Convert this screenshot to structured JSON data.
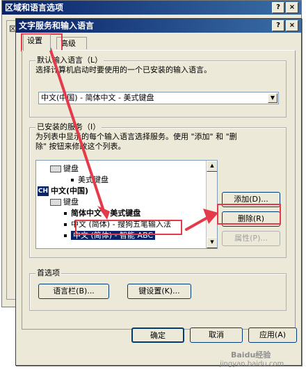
{
  "back_window": {
    "title": "区域和语言选项",
    "help_glyph": "?",
    "close_glyph": "×",
    "tab_fragment": "区"
  },
  "dialog": {
    "title": "文字服务和输入语言",
    "help_glyph": "?",
    "close_glyph": "×",
    "tabs": [
      {
        "label": "设置",
        "active": true
      },
      {
        "label": "高级",
        "active": false
      }
    ]
  },
  "default_language": {
    "legend": "默认输入语言（L）",
    "description": "选择计算机启动时要使用的一个已安装的输入语言。",
    "selected": "中文(中国) - 简体中文 - 美式键盘"
  },
  "installed_services": {
    "legend": "已安装的服务（I）",
    "description_line1": "为列表中显示的每个输入语言选择服务。使用 \"添加\" 和 \"删",
    "description_line2": "除\" 按钮来修改这个列表。",
    "items": [
      {
        "kind": "category",
        "icon": "keyboard-icon",
        "label": "键盘"
      },
      {
        "kind": "service",
        "label": "美式键盘"
      },
      {
        "kind": "language",
        "icon_text": "CH",
        "label": "中文(中国)"
      },
      {
        "kind": "category",
        "icon": "keyboard-icon",
        "label": "键盘"
      },
      {
        "kind": "service",
        "label": "简体中文 - 美式键盘",
        "bold": true
      },
      {
        "kind": "service",
        "label": "中文 (简体) - 搜狗五笔输入法"
      },
      {
        "kind": "service",
        "label": "中文 (简体) - 智能 ABC",
        "selected": true
      }
    ],
    "buttons": {
      "add": "添加(D)...",
      "remove": "删除(R)",
      "properties": "属性(P)..."
    }
  },
  "preferences": {
    "legend": "首选项",
    "language_bar": "语言栏(B)...",
    "key_settings": "键设置(K)..."
  },
  "footer": {
    "ok": "确定",
    "cancel": "取消",
    "apply": "应用(A)"
  },
  "watermark": {
    "line1": "Baidu经验",
    "line2": "jingyan.baidu.com"
  },
  "colors": {
    "annotation_red": "#e43a4a",
    "selection_blue": "#0a246a"
  }
}
